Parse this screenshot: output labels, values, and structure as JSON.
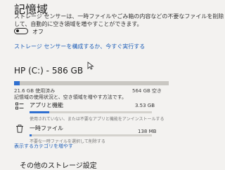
{
  "page": {
    "title": "記憶域"
  },
  "storage_sense": {
    "description": [
      "ストレージ センサーは、一時ファイルやごみ箱の内容などの不要なファイルを削除",
      "して、自動的に空き領域を増やすことができます。"
    ],
    "toggle_state": "オフ",
    "toggle_on": false,
    "configure_link": "ストレージ センサーを構成するか、今すぐ実行する"
  },
  "drive": {
    "title": "HP (C:) - 586 GB",
    "used_label": "21.6 GB 使用済み",
    "free_label": "564 GB 空き",
    "used_fraction": 0.037,
    "description": "記憶域の使用状況と、空き領域を増やす方法です。"
  },
  "categories": [
    {
      "name": "アプリと機能",
      "description": "使用されていない、または不要なアプリと機能をアンインストールする",
      "size": "3.53 GB",
      "fraction": 0.16,
      "icon": "apps-list-icon"
    },
    {
      "name": "一時ファイル",
      "description": "不要な一時ファイルを選択して削除する",
      "size": "138 MB",
      "fraction": 0.01,
      "icon": "trash-icon"
    }
  ],
  "more_categories_link": "表示するカテゴリを増やす",
  "other_settings_title": "その他のストレージ設定",
  "colors": {
    "accent": "#2f6fd0",
    "link": "#1f5fb8",
    "background": "#f3f2f0"
  }
}
